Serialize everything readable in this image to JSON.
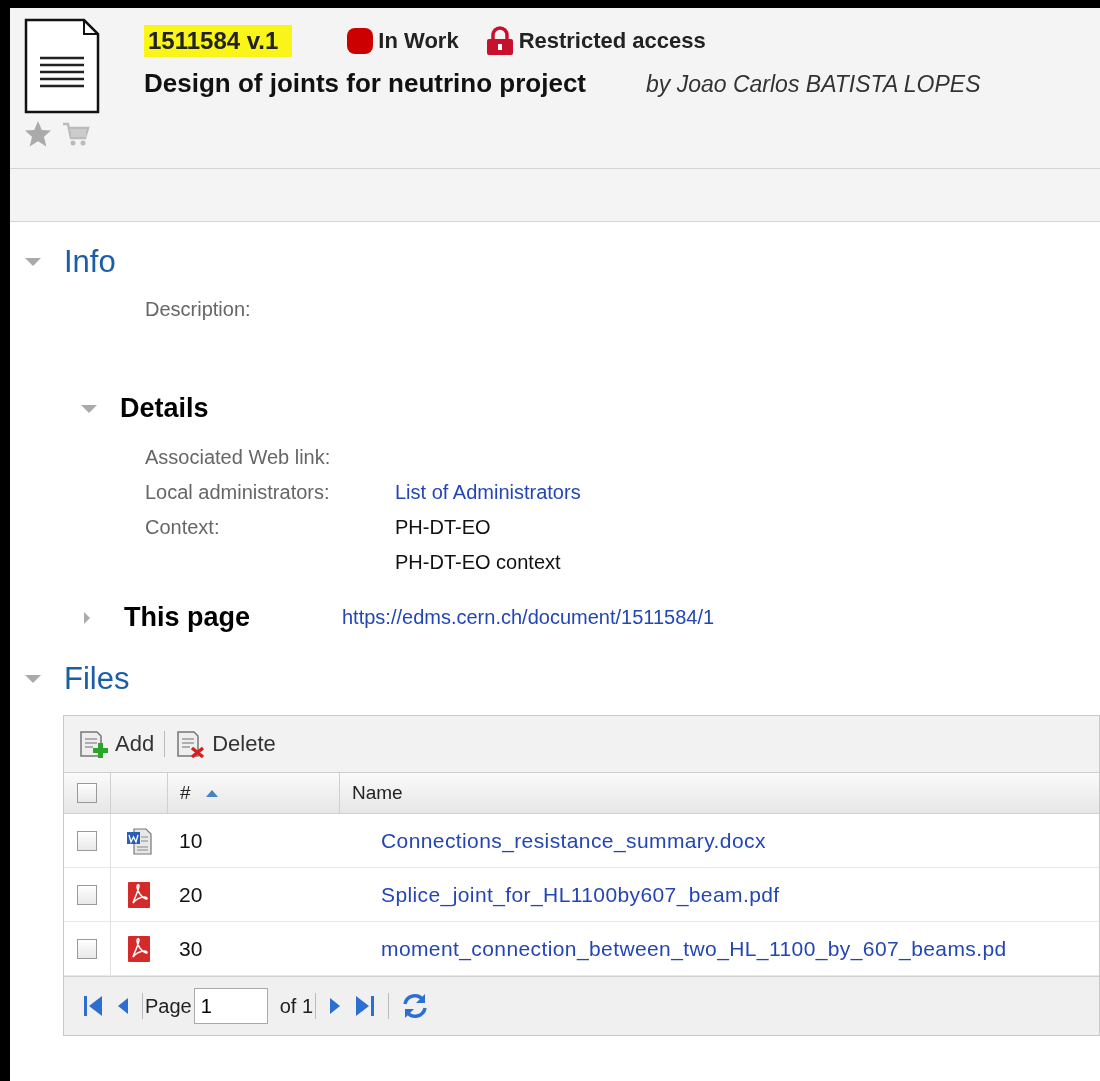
{
  "document": {
    "number": "1511584 v.1",
    "status": "In Work",
    "access": "Restricted access",
    "title": "Design of joints for neutrino project",
    "author": "by Joao Carlos BATISTA LOPES"
  },
  "info": {
    "heading": "Info",
    "expanded": true,
    "description_label": "Description:"
  },
  "details": {
    "heading": "Details",
    "expanded": true,
    "fields": [
      {
        "label": "Associated Web link:"
      },
      {
        "label": "Local administrators:",
        "values": [
          {
            "text": "List of Administrators",
            "kind": "link"
          }
        ]
      },
      {
        "label": "Context:",
        "values": [
          {
            "text": "PH-DT-EO",
            "kind": "text"
          },
          {
            "text": "PH-DT-EO context",
            "kind": "text"
          }
        ]
      }
    ]
  },
  "this_page": {
    "heading": "This page",
    "expanded": false,
    "url": "https://edms.cern.ch/document/1511584/1"
  },
  "files": {
    "heading": "Files",
    "expanded": true,
    "toolbar": [
      {
        "label": "Add",
        "kind": "add"
      },
      {
        "label": "Delete",
        "kind": "delete"
      }
    ],
    "select_all_checked": false,
    "columns": [
      {
        "label": "#",
        "kind": "sorted-ascending"
      },
      {
        "label": "Name",
        "kind": "unsorted"
      }
    ],
    "rows": [
      {
        "checked": false,
        "kind": "word",
        "number": "10",
        "name": "Connections_resistance_summary.docx"
      },
      {
        "checked": false,
        "kind": "pdf",
        "number": "20",
        "name": "Splice_joint_for_HL1100by607_beam.pdf"
      },
      {
        "checked": false,
        "kind": "pdf",
        "number": "30",
        "name": "moment_connection_between_two_HL_1100_by_607_beams.pd"
      }
    ],
    "pager": {
      "page_label": "Page",
      "page": "1",
      "of": "of 1"
    }
  }
}
